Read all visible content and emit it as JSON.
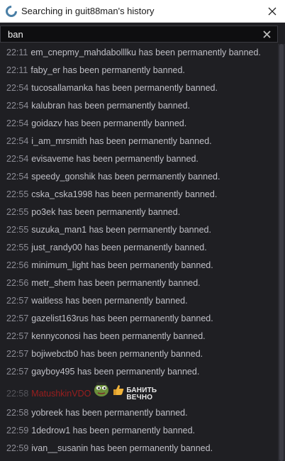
{
  "window": {
    "title": "Searching in guit88man's history"
  },
  "search": {
    "value": "ban"
  },
  "banned_suffix": "has been permanently banned.",
  "messages": [
    {
      "time": "22:11",
      "user": "em_cnepmy_mahdabolllku"
    },
    {
      "time": "22:11",
      "user": "faby_er"
    },
    {
      "time": "22:54",
      "user": "tucosallamanka"
    },
    {
      "time": "22:54",
      "user": "kalubran"
    },
    {
      "time": "22:54",
      "user": "goidazv"
    },
    {
      "time": "22:54",
      "user": "i_am_mrsmith"
    },
    {
      "time": "22:54",
      "user": "evisaveme"
    },
    {
      "time": "22:54",
      "user": "speedy_gonshik"
    },
    {
      "time": "22:55",
      "user": "cska_cska1998"
    },
    {
      "time": "22:55",
      "user": "po3ek"
    },
    {
      "time": "22:55",
      "user": "suzuka_man1"
    },
    {
      "time": "22:55",
      "user": "just_randy00"
    },
    {
      "time": "22:56",
      "user": "minimum_light"
    },
    {
      "time": "22:56",
      "user": "metr_shem"
    },
    {
      "time": "22:57",
      "user": "waitless"
    },
    {
      "time": "22:57",
      "user": "gazelist163rus"
    },
    {
      "time": "22:57",
      "user": "kennyconosi"
    },
    {
      "time": "22:57",
      "user": "bojiwebctb0"
    },
    {
      "time": "22:57",
      "user": "gayboy495"
    }
  ],
  "chat_message": {
    "time": "22:58",
    "user": "MatushkinVDO",
    "emote_text_line1": "БАНИТЬ",
    "emote_text_line2": "ВЕЧНО"
  },
  "messages_after": [
    {
      "time": "22:58",
      "user": "yobreek"
    },
    {
      "time": "22:59",
      "user": "1dedrow1"
    },
    {
      "time": "22:59",
      "user": "ivan__susanin"
    }
  ]
}
